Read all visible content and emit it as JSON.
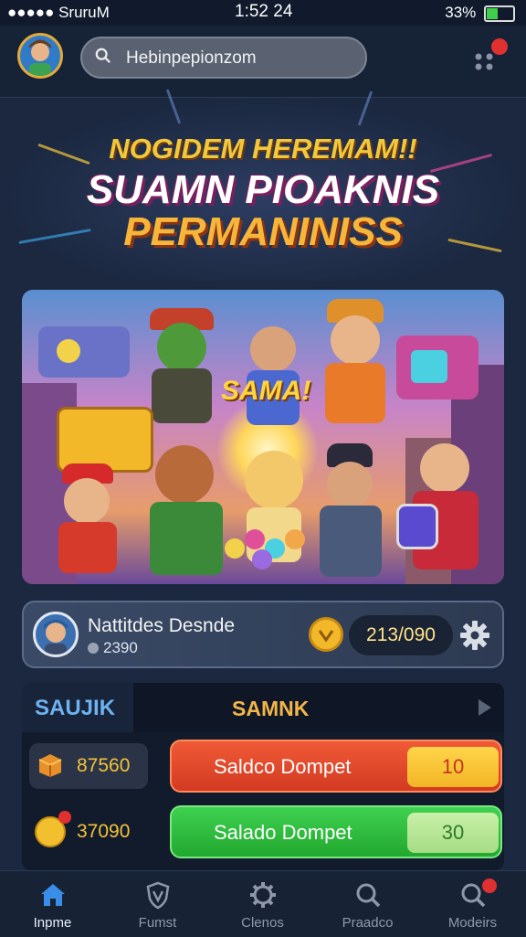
{
  "status_bar": {
    "carrier": "●●●●● SruruM",
    "time": "1:52 24",
    "battery": "33%"
  },
  "header": {
    "search_placeholder": "Hebinpepionzom"
  },
  "hero": {
    "line1": "NOGIDEM HEREMAM!!",
    "line2": "SUAMN PIOAKNIS",
    "line3": "PERMANINISS"
  },
  "banner": {
    "label": "SAMA!"
  },
  "profile": {
    "name": "Nattitdes Desnde",
    "score": "2390",
    "coins": "213/090"
  },
  "wallet": {
    "tab_active": "SAUJIK",
    "tab_other": "SAMNK",
    "rows": [
      {
        "chip_value": "87560",
        "button_label": "Saldco Dompet",
        "button_value": "10"
      },
      {
        "chip_value": "37090",
        "button_label": "Salado Dompet",
        "button_value": "30"
      }
    ]
  },
  "nav": {
    "items": [
      {
        "label": "Inpme",
        "icon": "home-icon"
      },
      {
        "label": "Fumst",
        "icon": "shield-icon"
      },
      {
        "label": "Clenos",
        "icon": "gear-icon"
      },
      {
        "label": "Praadco",
        "icon": "search-icon"
      },
      {
        "label": "Modeirs",
        "icon": "search-icon"
      }
    ]
  },
  "colors": {
    "background": "#1b2840",
    "accent": "#f2b64a",
    "active_tab": "#6fb2f0",
    "danger": "#d33a22",
    "success": "#22a82f"
  }
}
